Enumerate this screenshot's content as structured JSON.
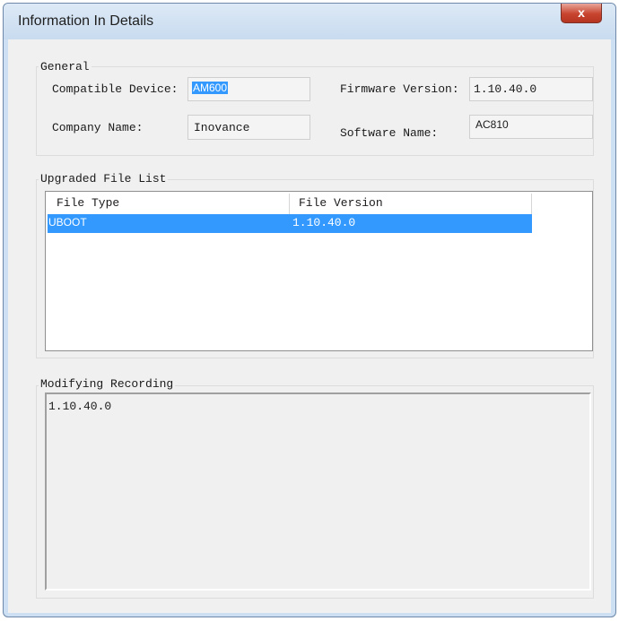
{
  "window": {
    "title": "Information In Details",
    "close_label": "x"
  },
  "general": {
    "title": "General",
    "compatible_device_label": "Compatible Device:",
    "compatible_device_value": "AM600",
    "firmware_version_label": "Firmware Version:",
    "firmware_version_value": "1.10.40.0",
    "company_name_label": "Company Name:",
    "company_name_value": "Inovance",
    "software_name_label": "Software Name:",
    "software_name_value": "AC810"
  },
  "upgraded_file_list": {
    "title": "Upgraded File List",
    "columns": [
      "File Type",
      "File Version"
    ],
    "rows": [
      {
        "file_type": "UBOOT",
        "file_version": "1.10.40.0"
      }
    ]
  },
  "modifying_recording": {
    "title": "Modifying Recording",
    "text": "1.10.40.0"
  }
}
